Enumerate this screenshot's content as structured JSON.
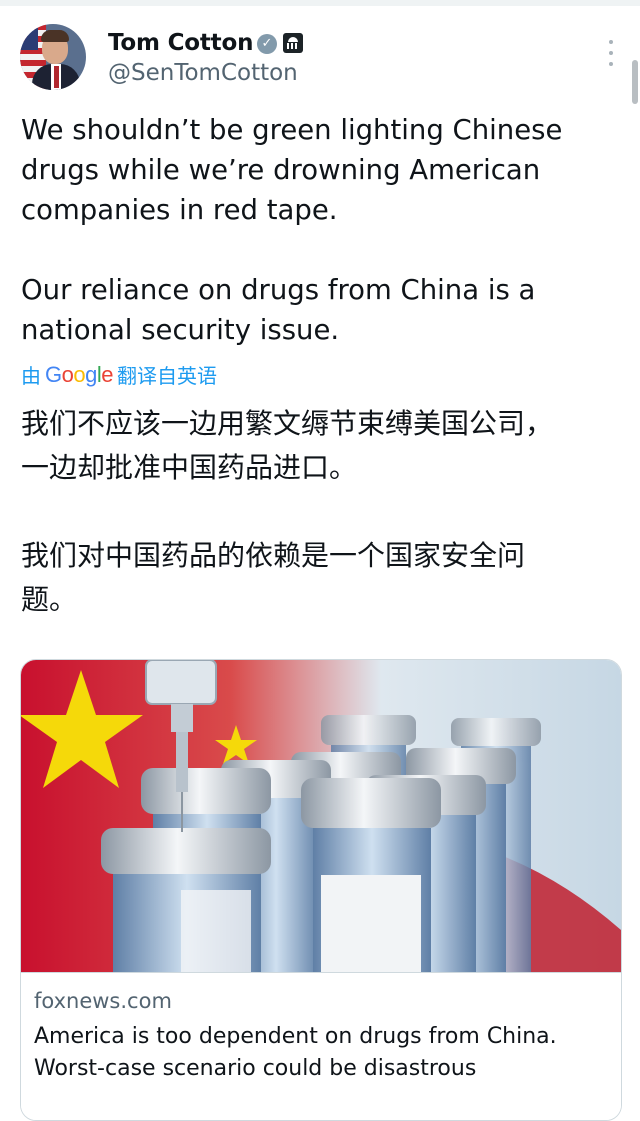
{
  "tweet": {
    "author_name": "Tom Cotton",
    "author_handle": "@SenTomCotton",
    "verified_icon": "verified-check",
    "affiliation_icon": "government-building",
    "text": "We shouldn’t be green lighting Chinese\ndrugs while we’re drowning American\ncompanies in red tape.\n\nOur reliance on drugs from China is a\nnational security issue.",
    "translation_prefix": "由",
    "translation_suffix": "翻译自英语",
    "translation_provider": "Google",
    "translated_text": "我们不应该一边用繁文缛节束缚美国公司，\n一边却批准中国药品进口。\n\n我们对中国药品的依赖是一个国家安全问\n题。"
  },
  "card": {
    "image": "vaccine-vials-china-flag",
    "domain": "foxnews.com",
    "headline": "America is too dependent on drugs from China.\nWorst-case scenario could be disastrous"
  },
  "colors": {
    "link": "#1d9bf0",
    "muted": "#536471",
    "text": "#0f1419",
    "border": "#cfd9de"
  }
}
